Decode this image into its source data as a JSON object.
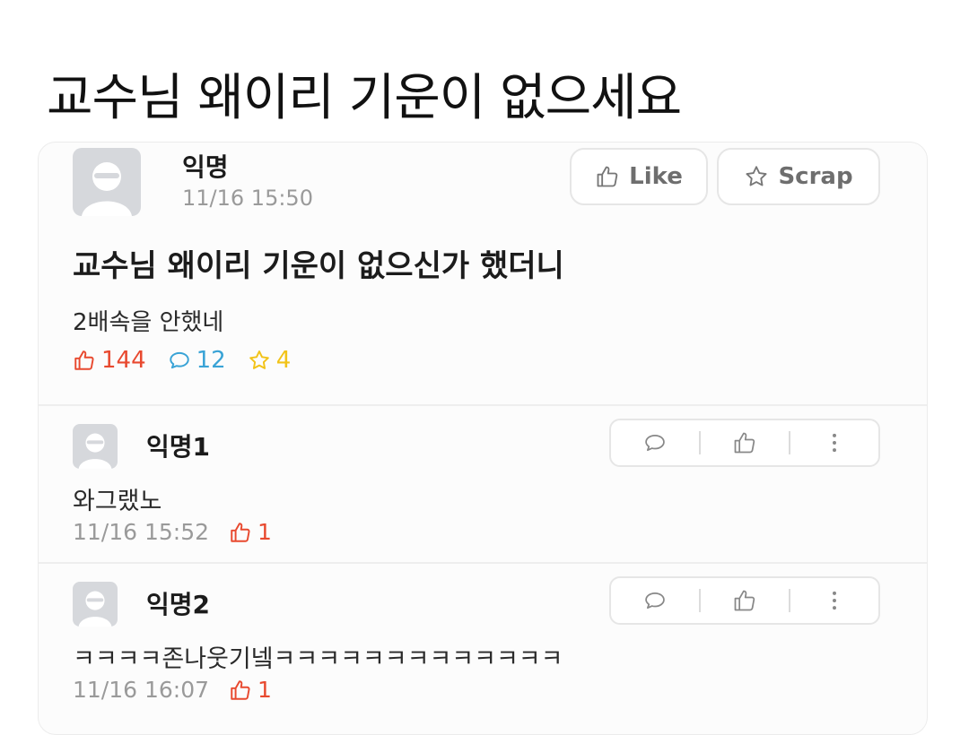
{
  "headline": "교수님 왜이리 기운이 없으세요",
  "post": {
    "author": "익명",
    "time": "11/16 15:50",
    "like_button": "Like",
    "scrap_button": "Scrap",
    "title": "교수님 왜이리 기운이 없으신가 했더니",
    "body": "2배속을 안했네",
    "likes": "144",
    "comments": "12",
    "scraps": "4"
  },
  "comments": [
    {
      "author": "익명1",
      "text": "와그랬노",
      "time": "11/16 15:52",
      "likes": "1"
    },
    {
      "author": "익명2",
      "text": "ㅋㅋㅋㅋ존나웃기넼ㅋㅋㅋㅋㅋㅋㅋㅋㅋㅋㅋㅋㅋ",
      "time": "11/16 16:07",
      "likes": "1"
    }
  ],
  "colors": {
    "like_red": "#e8492f",
    "comment_blue": "#39a3d6",
    "scrap_yellow": "#f2c318",
    "meta_gray": "#9a9a9a"
  },
  "icons": [
    "thumbs-up-icon",
    "star-icon",
    "speech-bubble-icon",
    "more-vertical-icon",
    "default-avatar-icon"
  ]
}
